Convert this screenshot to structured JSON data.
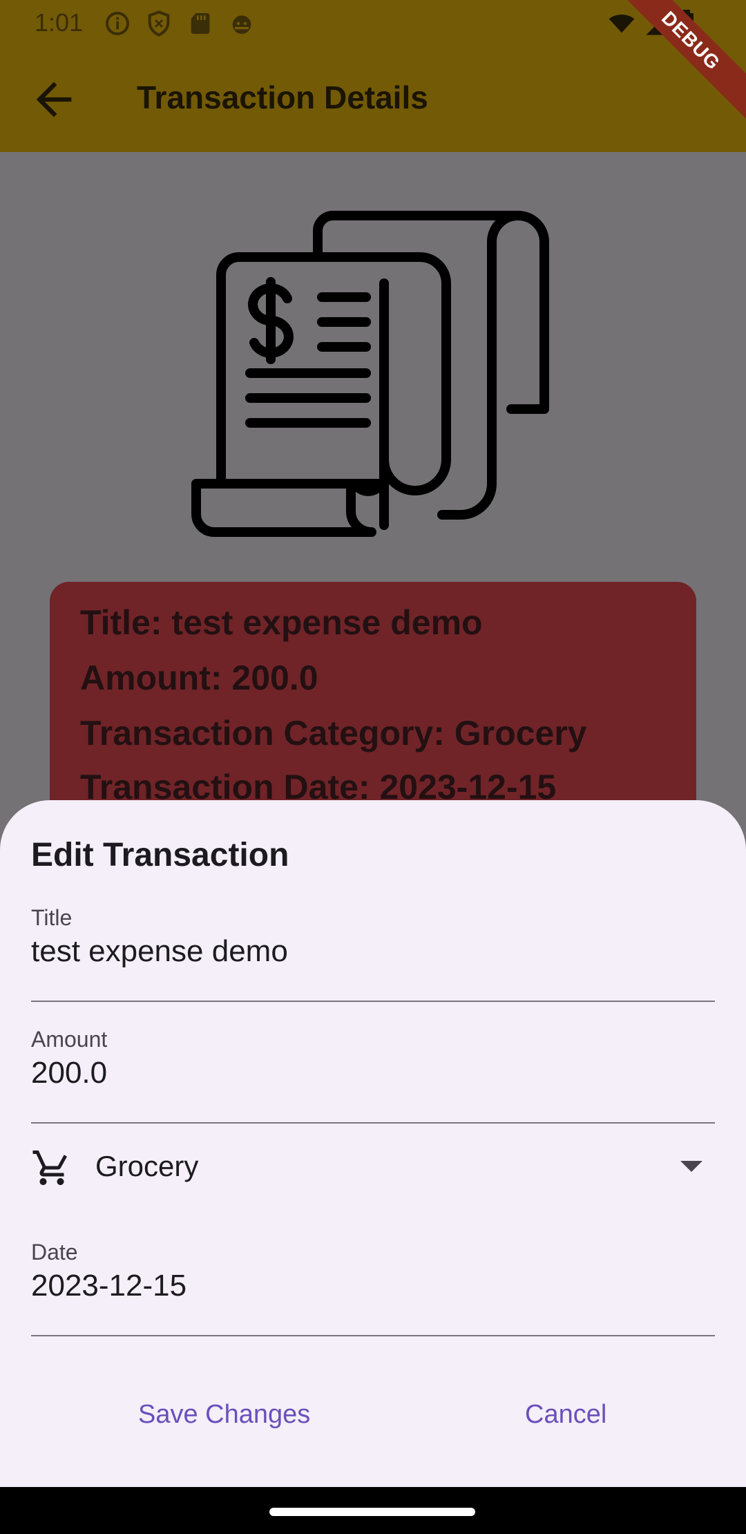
{
  "status_bar": {
    "time": "1:01",
    "icons": [
      "info-icon",
      "shield-icon",
      "sd-card-icon",
      "android-face-icon",
      "wifi-icon",
      "signal-icon",
      "battery-icon"
    ]
  },
  "app_bar": {
    "title": "Transaction Details",
    "back_icon": "arrow-back-icon",
    "debug_label": "DEBUG",
    "color": "#735a06"
  },
  "details_card": {
    "title_line": "Title: test expense demo",
    "amount_line": "Amount: 200.0",
    "category_line": "Transaction Category: Grocery",
    "date_line": "Transaction Date: 2023-12-15",
    "color": "#702428"
  },
  "edit_sheet": {
    "heading": "Edit Transaction",
    "title_field": {
      "label": "Title",
      "value": "test expense demo"
    },
    "amount_field": {
      "label": "Amount",
      "value": "200.0"
    },
    "category_dropdown": {
      "icon": "shopping-cart-icon",
      "value": "Grocery"
    },
    "date_field": {
      "label": "Date",
      "value": "2023-12-15"
    },
    "save_label": "Save Changes",
    "cancel_label": "Cancel",
    "accent": "#6b4fbb",
    "background": "#f4eff9"
  }
}
